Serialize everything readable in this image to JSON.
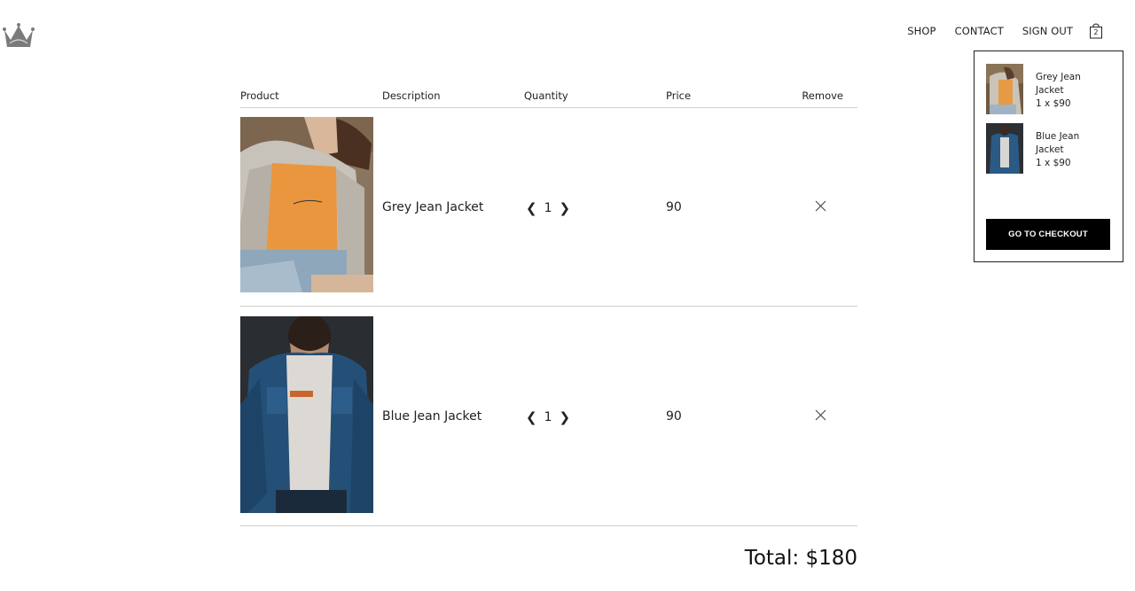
{
  "header": {
    "logo_icon": "crown-icon",
    "nav": {
      "shop": "SHOP",
      "contact": "CONTACT",
      "sign_out": "SIGN OUT"
    },
    "bag_icon": "shopping-bag-icon",
    "bag_count": "2"
  },
  "cart_dropdown": {
    "items": [
      {
        "name": "Grey Jean Jacket",
        "qty_price": "1 x $90"
      },
      {
        "name": "Blue Jean Jacket",
        "qty_price": "1 x $90"
      }
    ],
    "checkout_label": "GO TO CHECKOUT"
  },
  "table": {
    "headers": {
      "product": "Product",
      "description": "Description",
      "quantity": "Quantity",
      "price": "Price",
      "remove": "Remove"
    },
    "rows": [
      {
        "description": "Grey Jean Jacket",
        "quantity": "1",
        "price": "90"
      },
      {
        "description": "Blue Jean Jacket",
        "quantity": "1",
        "price": "90"
      }
    ]
  },
  "total": "Total: $180",
  "colors": {
    "text": "#222222",
    "button_bg": "#000000",
    "button_text": "#ffffff",
    "divider": "#cfcfcf"
  }
}
